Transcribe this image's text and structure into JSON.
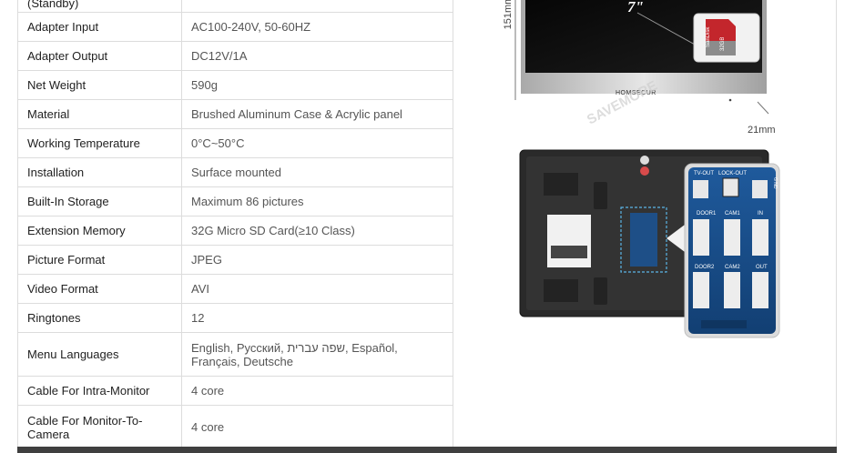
{
  "spec_table": {
    "rows": [
      {
        "key": "(Standby)",
        "value": ""
      },
      {
        "key": "Adapter Input",
        "value": "AC100-240V, 50-60HZ"
      },
      {
        "key": "Adapter Output",
        "value": "DC12V/1A"
      },
      {
        "key": "Net Weight",
        "value": "590g"
      },
      {
        "key": "Material",
        "value": "Brushed Aluminum Case & Acrylic panel"
      },
      {
        "key": "Working Temperature",
        "value": "0°C~50°C"
      },
      {
        "key": "Installation",
        "value": "Surface mounted"
      },
      {
        "key": "Built-In Storage",
        "value": "Maximum 86 pictures"
      },
      {
        "key": "Extension Memory",
        "value": "32G Micro SD Card(≥10 Class)"
      },
      {
        "key": "Picture Format",
        "value": "JPEG"
      },
      {
        "key": "Video Format",
        "value": "AVI"
      },
      {
        "key": "Ringtones",
        "value": "12"
      },
      {
        "key": "Menu Languages",
        "value": "English, Русский, שפה עברית, Español, Français, Deutsche"
      },
      {
        "key": "Cable For Intra-Monitor",
        "value": "4 core"
      },
      {
        "key": "Cable For Monitor-To-Camera",
        "value": "4 core"
      }
    ]
  },
  "product_image": {
    "front": {
      "screen_size": "7\"",
      "height_dim": "151mm",
      "depth_dim": "21mm",
      "brand": "HOMSECUR",
      "watermark": "SAVEMORE",
      "sd_card": {
        "brand": "SanDisk",
        "capacity": "32GB"
      }
    },
    "back": {
      "ports": [
        "TV-OUT",
        "LOCK-OUT",
        "DOOR1",
        "CAM1",
        "IN",
        "DOOR2",
        "CAM2",
        "OUT"
      ],
      "side_label": "G ND"
    }
  },
  "colors": {
    "border": "#dcdcdc",
    "bottom_bar": "#3f3f3f",
    "pcb_blue": "#1a4f8f"
  }
}
